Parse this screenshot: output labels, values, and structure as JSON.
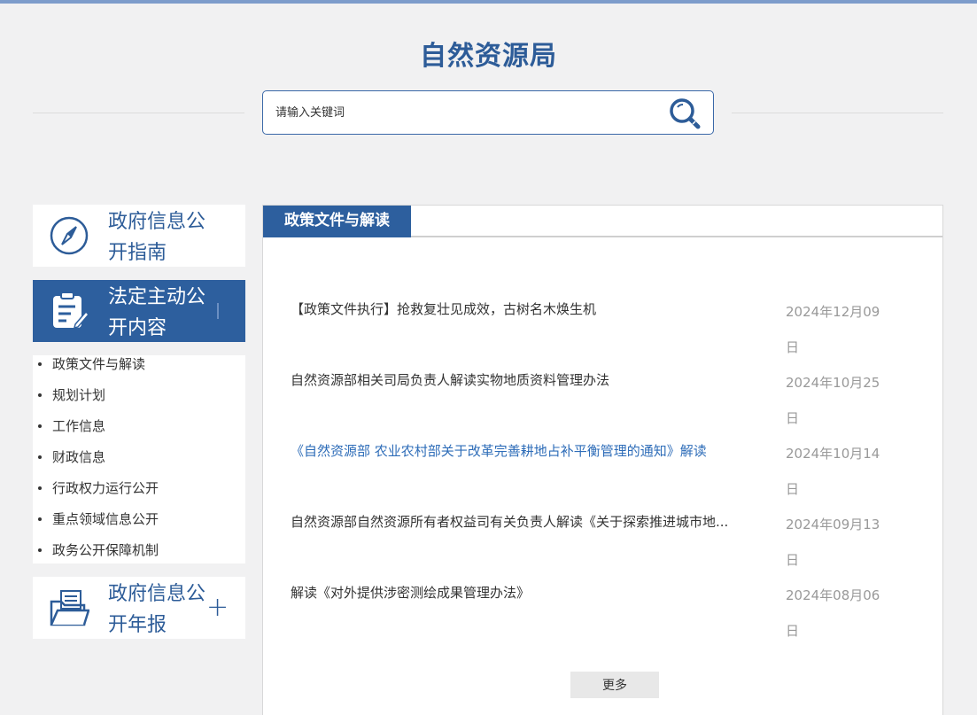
{
  "header": {
    "title": "自然资源局",
    "search_placeholder": "请输入关键词"
  },
  "sidebar": {
    "cards": [
      {
        "label": "政府信息公开指南",
        "icon": "compass-icon"
      },
      {
        "label": "法定主动公开内容",
        "icon": "document-edit-icon"
      },
      {
        "label": "政府信息公开年报",
        "icon": "folder-icon"
      }
    ],
    "sub_items": [
      "政策文件与解读",
      "规划计划",
      "工作信息",
      "财政信息",
      "行政权力运行公开",
      "重点领域信息公开",
      "政务公开保障机制"
    ],
    "expand_symbol": "+"
  },
  "main": {
    "tab_label": "政策文件与解读",
    "items": [
      {
        "title": "【政策文件执行】抢救复壮见成效，古树名木焕生机",
        "date": "2024年12月09日"
      },
      {
        "title": "自然资源部相关司局负责人解读实物地质资料管理办法",
        "date": "2024年10月25日"
      },
      {
        "title": "《自然资源部 农业农村部关于改革完善耕地占补平衡管理的通知》解读",
        "date": "2024年10月14日"
      },
      {
        "title": "自然资源部自然资源所有者权益司有关负责人解读《关于探索推进城市地...",
        "date": "2024年09月13日"
      },
      {
        "title": "解读《对外提供涉密测绘成果管理办法》",
        "date": "2024年08月06日"
      }
    ],
    "more_label": "更多"
  },
  "colors": {
    "brand": "#2d5c98",
    "active_bg": "#2d5f9e",
    "link_highlight": "#2d6cb8",
    "date": "#999999"
  }
}
